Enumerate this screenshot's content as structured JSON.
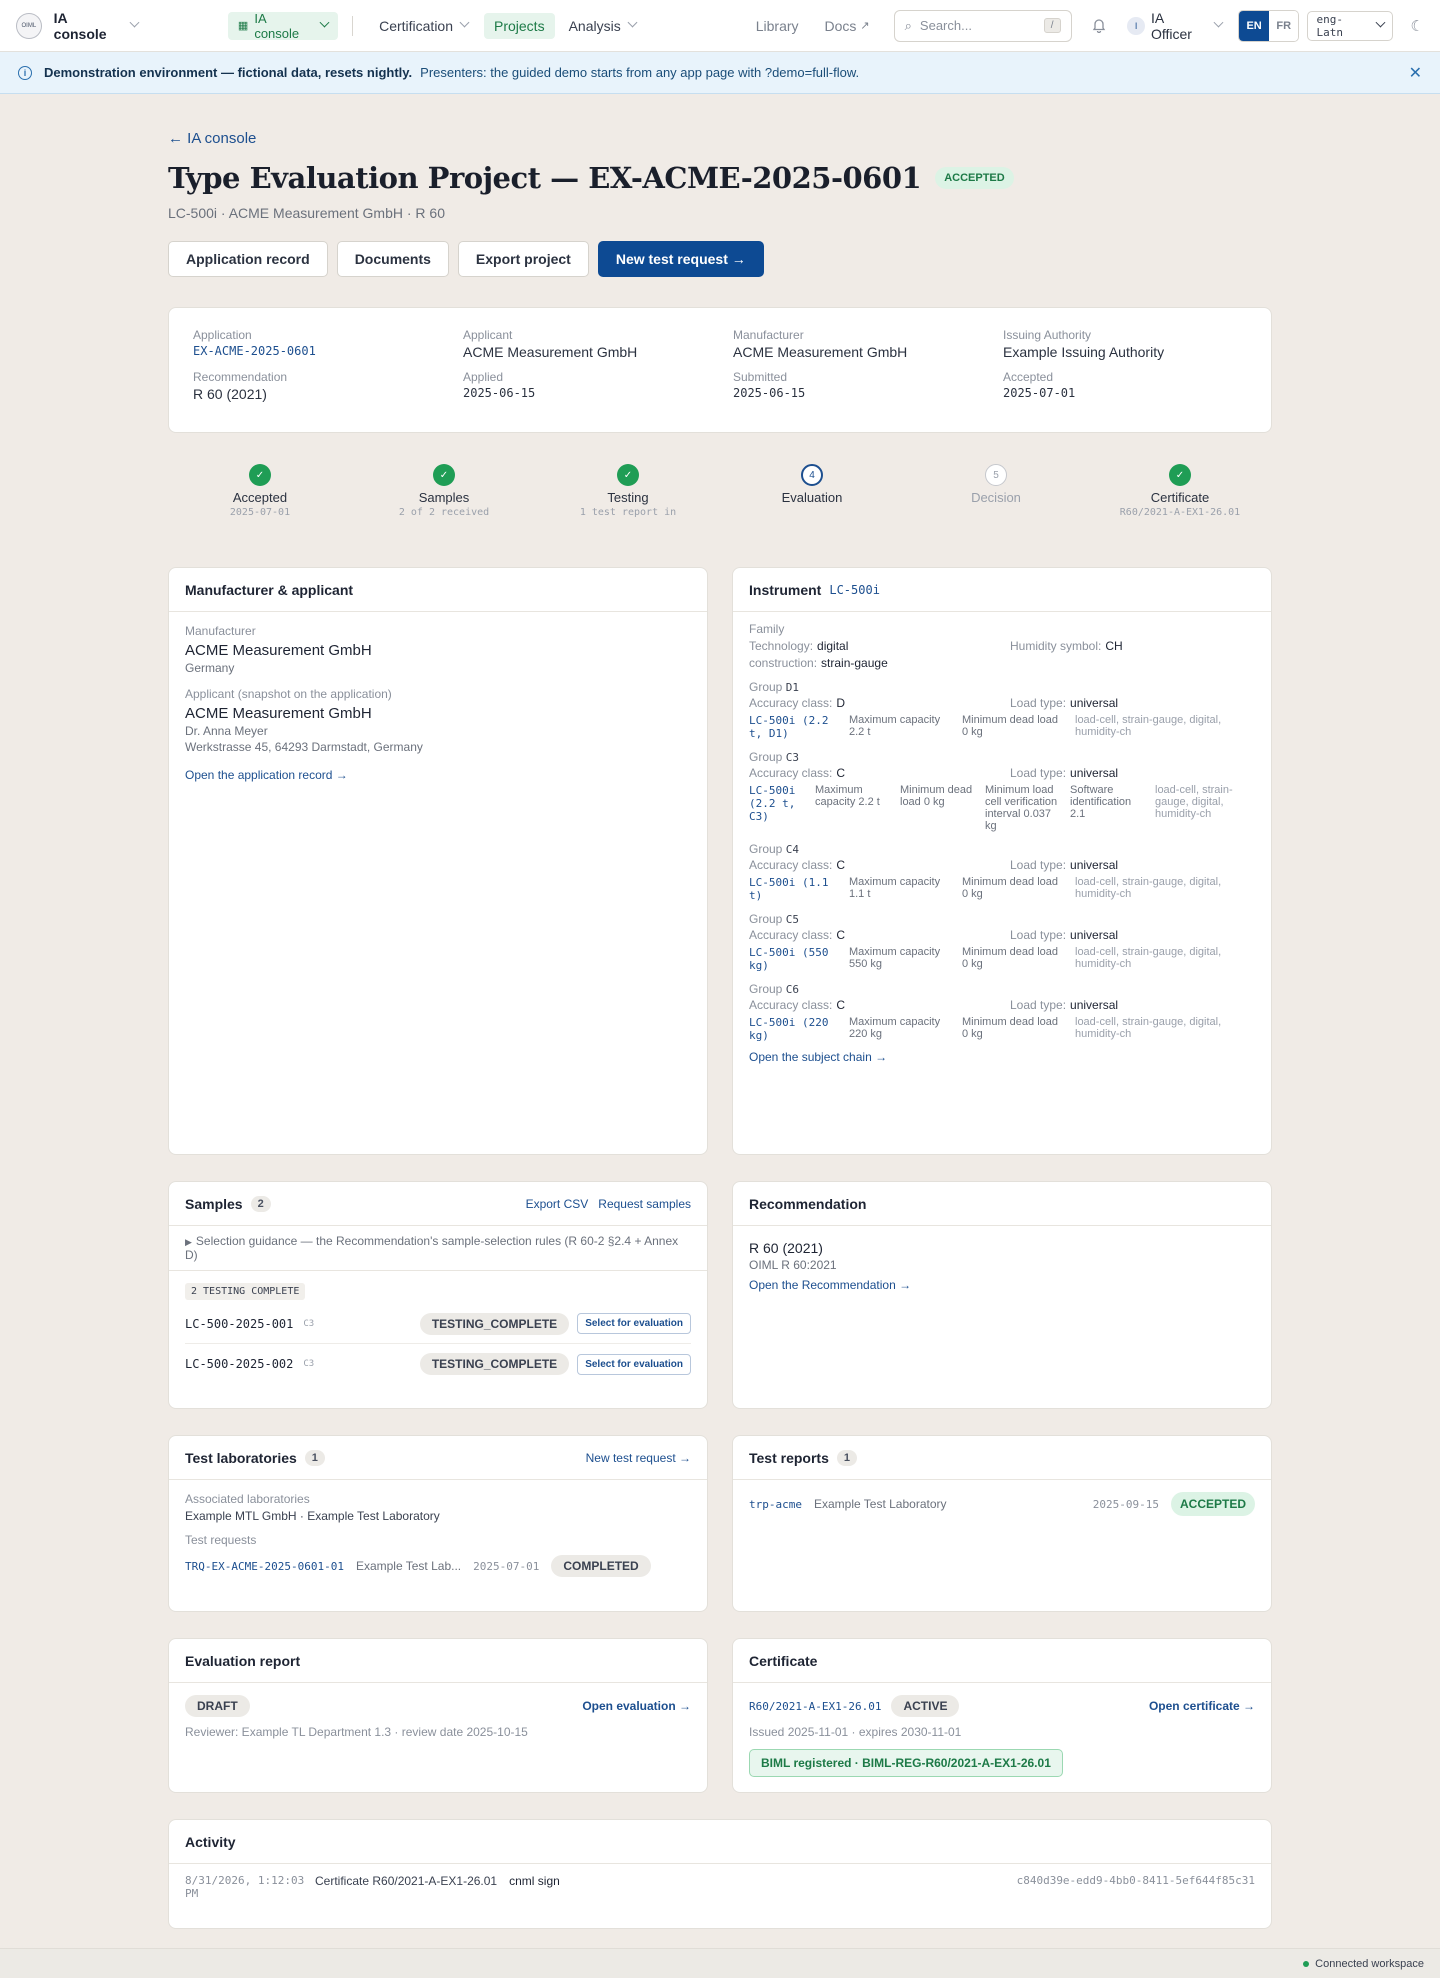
{
  "topbar": {
    "brand": "IA console",
    "switcher": "IA console",
    "nav": [
      "Certification",
      "Projects",
      "Analysis"
    ],
    "library": "Library",
    "docs": "Docs",
    "search_placeholder": "Search...",
    "search_kbd": "/",
    "user_initial": "I",
    "user": "IA Officer",
    "lang_en": "EN",
    "lang_fr": "FR",
    "script": "eng-Latn"
  },
  "banner": {
    "bold": "Demonstration environment — fictional data, resets nightly.",
    "text": "Presenters: the guided demo starts from any app page with ?demo=full-flow."
  },
  "header": {
    "back": "← IA console",
    "title": "Type Evaluation Project — EX-ACME-2025-0601",
    "status": "ACCEPTED",
    "subtitle": "LC-500i · ACME Measurement GmbH · R 60",
    "buttons": [
      "Application record",
      "Documents",
      "Export project",
      "New test request →"
    ]
  },
  "summary": {
    "application_label": "Application",
    "application": "EX-ACME-2025-0601",
    "applicant_label": "Applicant",
    "applicant": "ACME Measurement GmbH",
    "manufacturer_label": "Manufacturer",
    "manufacturer": "ACME Measurement GmbH",
    "authority_label": "Issuing Authority",
    "authority": "Example Issuing Authority",
    "recommendation_label": "Recommendation",
    "recommendation": "R 60 (2021)",
    "applied_label": "Applied",
    "applied": "2025-06-15",
    "submitted_label": "Submitted",
    "submitted": "2025-06-15",
    "accepted_label": "Accepted",
    "accepted": "2025-07-01"
  },
  "steps": [
    {
      "num": "✓",
      "label": "Accepted",
      "sub": "2025-07-01"
    },
    {
      "num": "✓",
      "label": "Samples",
      "sub": "2 of 2 received"
    },
    {
      "num": "✓",
      "label": "Testing",
      "sub": "1 test report in"
    },
    {
      "num": "4",
      "label": "Evaluation",
      "sub": ""
    },
    {
      "num": "5",
      "label": "Decision",
      "sub": ""
    },
    {
      "num": "✓",
      "label": "Certificate",
      "sub": "R60/2021-A-EX1-26.01"
    }
  ],
  "manufacturer_card": {
    "title": "Manufacturer & applicant",
    "m_label": "Manufacturer",
    "m_name": "ACME Measurement GmbH",
    "m_country": "Germany",
    "a_label": "Applicant (snapshot on the application)",
    "a_name": "ACME Measurement GmbH",
    "a_contact": "Dr. Anna Meyer",
    "a_address": "Werkstrasse 45, 64293 Darmstadt, Germany",
    "link": "Open the application record →"
  },
  "instrument": {
    "title": "Instrument",
    "code": "LC-500i",
    "family_label": "Family",
    "technology_label": "Technology:",
    "technology": "digital",
    "humidity_label": "Humidity symbol:",
    "humidity": "CH",
    "construction_label": "construction:",
    "construction": "strain-gauge",
    "group_label": "Group",
    "accuracy_label": "Accuracy class:",
    "load_label": "Load type:",
    "groups": [
      {
        "id": "D1",
        "acc": "D",
        "load": "universal",
        "name": "LC-500i (2.2 t, D1)",
        "cols": [
          "Maximum capacity 2.2 t",
          "Minimum dead load 0 kg"
        ],
        "tags": "load-cell, strain-gauge, digital, humidity-ch"
      },
      {
        "id": "C3",
        "acc": "C",
        "load": "universal",
        "name": "LC-500i (2.2 t, C3)",
        "cols": [
          "Maximum capacity 2.2 t",
          "Minimum dead load 0 kg",
          "Minimum load cell verification interval 0.037 kg",
          "Software identification 2.1"
        ],
        "tags": "load-cell, strain-gauge, digital, humidity-ch"
      },
      {
        "id": "C4",
        "acc": "C",
        "load": "universal",
        "name": "LC-500i (1.1 t)",
        "cols": [
          "Maximum capacity 1.1 t",
          "Minimum dead load 0 kg"
        ],
        "tags": "load-cell, strain-gauge, digital, humidity-ch"
      },
      {
        "id": "C5",
        "acc": "C",
        "load": "universal",
        "name": "LC-500i (550 kg)",
        "cols": [
          "Maximum capacity 550 kg",
          "Minimum dead load 0 kg"
        ],
        "tags": "load-cell, strain-gauge, digital, humidity-ch"
      },
      {
        "id": "C6",
        "acc": "C",
        "load": "universal",
        "name": "LC-500i (220 kg)",
        "cols": [
          "Maximum capacity 220 kg",
          "Minimum dead load 0 kg"
        ],
        "tags": "load-cell, strain-gauge, digital, humidity-ch"
      }
    ],
    "link": "Open the subject chain →"
  },
  "samples": {
    "title": "Samples",
    "count": "2",
    "export": "Export CSV",
    "request": "Request samples",
    "guidance": "Selection guidance — the Recommendation's sample-selection rules (R 60-2 §2.4 + Annex D)",
    "chip": "2 TESTING COMPLETE",
    "rows": [
      {
        "id": "LC-500-2025-001",
        "group": "C3",
        "status": "TESTING_COMPLETE",
        "action": "Select for evaluation"
      },
      {
        "id": "LC-500-2025-002",
        "group": "C3",
        "status": "TESTING_COMPLETE",
        "action": "Select for evaluation"
      }
    ]
  },
  "recommendation": {
    "title": "Recommendation",
    "name": "R 60 (2021)",
    "ref": "OIML R 60:2021",
    "link": "Open the Recommendation →"
  },
  "labs": {
    "title": "Test laboratories",
    "count": "1",
    "new": "New test request →",
    "assoc_label": "Associated laboratories",
    "assoc": "Example MTL GmbH · Example Test Laboratory",
    "req_label": "Test requests",
    "req_id": "TRQ-EX-ACME-2025-0601-01",
    "req_lab": "Example Test Lab...",
    "req_date": "2025-07-01",
    "req_status": "COMPLETED"
  },
  "reports": {
    "title": "Test reports",
    "count": "1",
    "id": "trp-acme",
    "lab": "Example Test Laboratory",
    "date": "2025-09-15",
    "status": "ACCEPTED"
  },
  "evaluation": {
    "title": "Evaluation report",
    "status": "DRAFT",
    "link": "Open evaluation →",
    "meta": "Reviewer: Example TL Department 1.3 · review date 2025-10-15"
  },
  "certificate": {
    "title": "Certificate",
    "id": "R60/2021-A-EX1-26.01",
    "status": "ACTIVE",
    "link": "Open certificate →",
    "meta": "Issued 2025-11-01 · expires 2030-11-01",
    "biml": "BIML registered · BIML-REG-R60/2021-A-EX1-26.01"
  },
  "activity": {
    "title": "Activity",
    "time": "8/31/2026, 1:12:03 PM",
    "text": "Certificate R60/2021-A-EX1-26.01",
    "actor": "cnml sign",
    "hash": "c840d39e-edd9-4bb0-8411-5ef644f85c31"
  },
  "footer": "Connected workspace",
  "colors": {
    "accent": "#0d4a93",
    "success": "#1f9d55",
    "background": "#f0ebe6"
  }
}
